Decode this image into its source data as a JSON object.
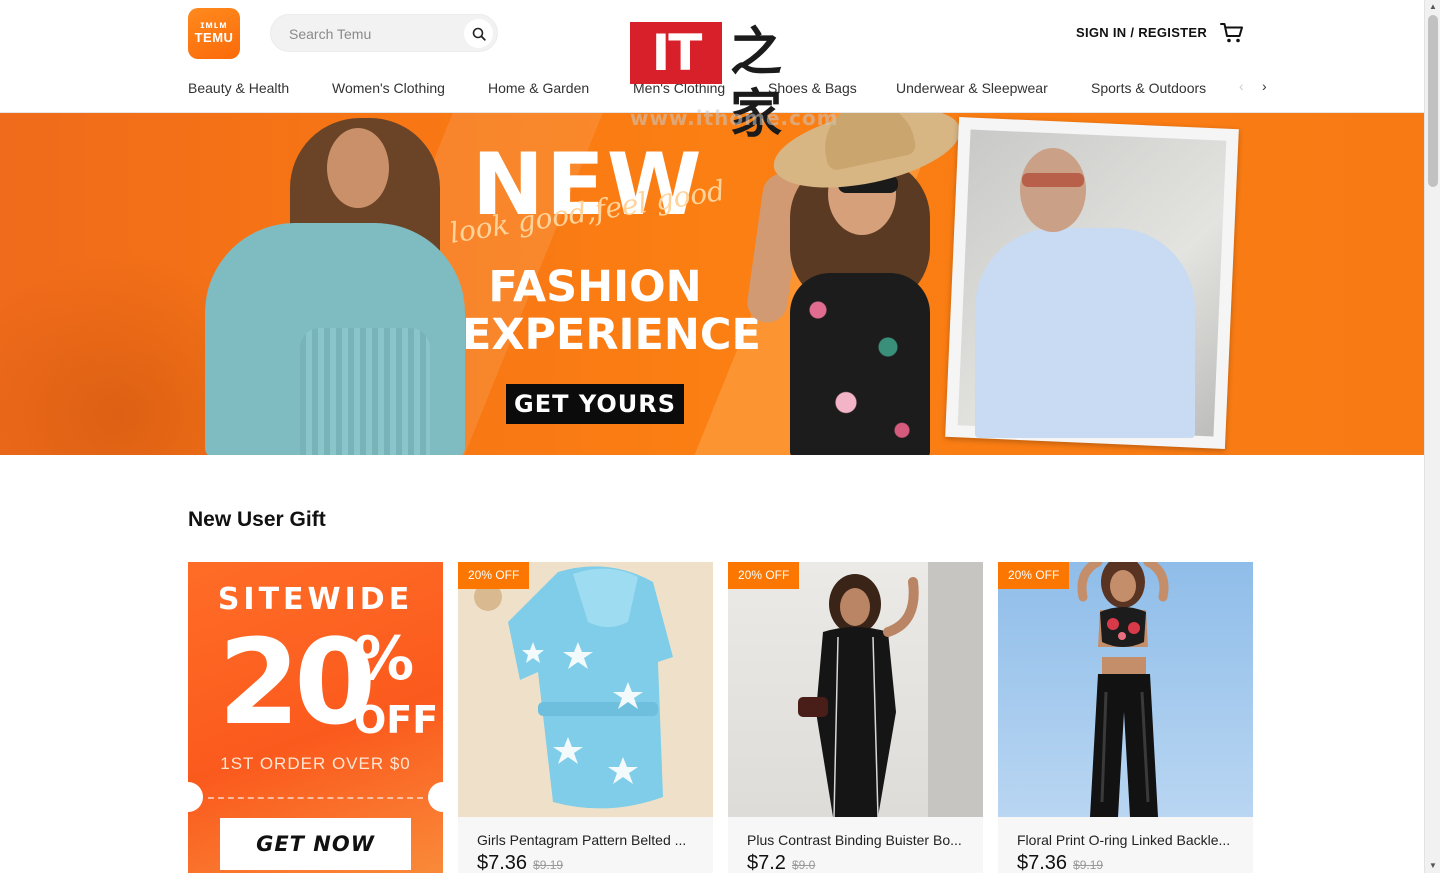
{
  "header": {
    "logo": {
      "glyphs": "ɪᴍʟᴍ",
      "word": "TEMU"
    },
    "search": {
      "placeholder": "Search Temu"
    },
    "sign_in": "SIGN IN / REGISTER",
    "categories": [
      "Beauty & Health",
      "Women's Clothing",
      "Home & Garden",
      "Men's Clothing",
      "Shoes & Bags",
      "Underwear & Sleepwear",
      "Sports & Outdoors"
    ],
    "prev_arrow": "‹",
    "next_arrow": "›"
  },
  "watermark": {
    "brand": "IT",
    "chinese": "之家",
    "url": "www.ithome.com"
  },
  "banner": {
    "headline": "NEW",
    "script_text": "look good,feel good",
    "line1": "FASHION",
    "line2": "EXPERIENCE",
    "button": "GET YOURS"
  },
  "gift_section": {
    "title": "New User Gift",
    "card": {
      "sitewide": "SITEWIDE",
      "percent": "20",
      "percent_symbol": "%",
      "off": "OFF",
      "condition": "1ST ORDER OVER $0",
      "button": "GET NOW"
    },
    "products": [
      {
        "badge": "20% OFF",
        "name": "Girls Pentagram Pattern Belted ...",
        "price": "$7.36",
        "original_price": "$9.19"
      },
      {
        "badge": "20% OFF",
        "name": "Plus Contrast Binding Buister Bo...",
        "price": "$7.2",
        "original_price": "$9.0"
      },
      {
        "badge": "20% OFF",
        "name": "Floral Print O-ring Linked Backle...",
        "price": "$7.36",
        "original_price": "$9.19"
      }
    ]
  },
  "colors": {
    "brand": "#fb7701",
    "banner": "#f77514",
    "badge": "#fb7701"
  }
}
